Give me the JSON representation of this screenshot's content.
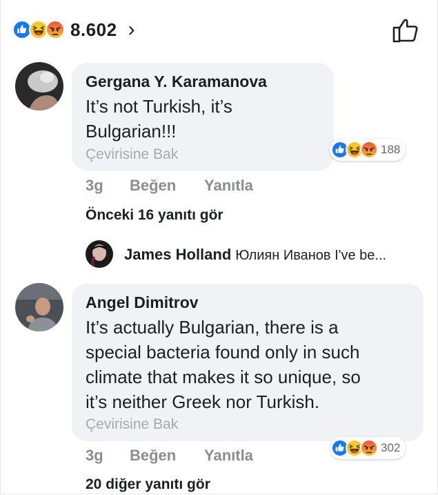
{
  "header": {
    "reaction_count": "8.602",
    "chevron": "›",
    "reaction_icons": [
      "like-icon",
      "haha-icon",
      "angry-icon"
    ],
    "like_icon": "thumbs-up-outline-icon"
  },
  "comments": [
    {
      "author": "Gergana Y. Karamanova",
      "text_lines": [
        "It’s not Turkish, it’s",
        "Bulgarian!!!"
      ],
      "translate": "Çevirisine Bak",
      "reaction_count": "188",
      "time": "3g",
      "like_label": "Beğen",
      "reply_label": "Yanıtla",
      "more_replies": "Önceki 16 yanıtı gör",
      "reply": {
        "author": "James Holland",
        "snippet": "Юлиян Иванов I've be..."
      }
    },
    {
      "author": "Angel Dimitrov",
      "text_lines": [
        "It’s actually Bulgarian, there is a",
        "special bacteria found only in such",
        "climate that makes it so unique, so",
        "it’s neither Greek nor Turkish."
      ],
      "translate": "Çevirisine Bak",
      "reaction_count": "302",
      "time": "3g",
      "like_label": "Beğen",
      "reply_label": "Yanıtla",
      "more_replies": "20 diğer yanıtı gör"
    }
  ],
  "colors": {
    "like_blue": "#1877f2",
    "haha_yellow": "#f7c62f",
    "angry_red": "#e9553a",
    "bubble_bg": "#f0f2f5",
    "meta_gray": "#8a8d91"
  }
}
